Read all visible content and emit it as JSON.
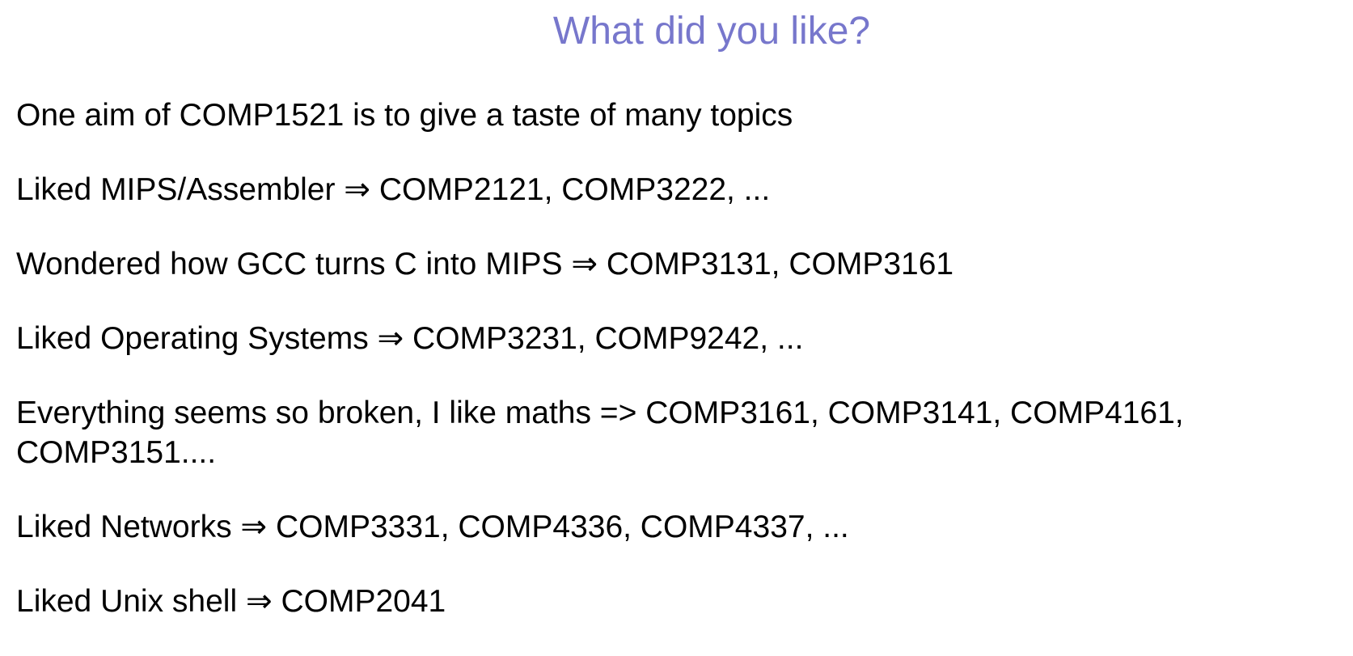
{
  "slide": {
    "title": "What did you like?",
    "title_color": "#7777cc",
    "text_color": "#000000",
    "items": [
      "One aim of COMP1521 is to give a taste of many topics",
      "Liked MIPS/Assembler ⇒ COMP2121, COMP3222, ...",
      "Wondered how GCC turns C into MIPS ⇒ COMP3131, COMP3161",
      "Liked Operating Systems ⇒ COMP3231, COMP9242, ...",
      "Everything seems so broken, I like maths => COMP3161, COMP3141, COMP4161, COMP3151....",
      "Liked Networks ⇒ COMP3331, COMP4336, COMP4337, ...",
      "Liked Unix shell ⇒ COMP2041"
    ]
  }
}
